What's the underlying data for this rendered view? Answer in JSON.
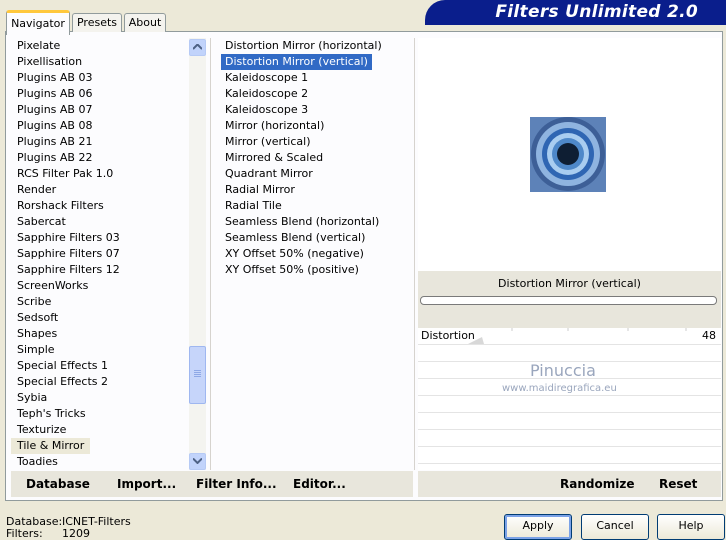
{
  "tabs": [
    {
      "label": "Navigator"
    },
    {
      "label": "Presets"
    },
    {
      "label": "About"
    }
  ],
  "banner_title": "Filters Unlimited 2.0",
  "categories": [
    "Pixelate",
    "Pixellisation",
    "Plugins AB 03",
    "Plugins AB 06",
    "Plugins AB 07",
    "Plugins AB 08",
    "Plugins AB 21",
    "Plugins AB 22",
    "RCS Filter Pak 1.0",
    "Render",
    "Rorshack Filters",
    "Sabercat",
    "Sapphire Filters 03",
    "Sapphire Filters 07",
    "Sapphire Filters 12",
    "ScreenWorks",
    "Scribe",
    "Sedsoft",
    "Shapes",
    "Simple",
    "Special Effects 1",
    "Special Effects 2",
    "Sybia",
    "Teph's Tricks",
    "Texturize",
    "Tile & Mirror",
    "Toadies"
  ],
  "selected_category": "Tile & Mirror",
  "filters": [
    "Distortion Mirror (horizontal)",
    "Distortion Mirror (vertical)",
    "Kaleidoscope 1",
    "Kaleidoscope 2",
    "Kaleidoscope 3",
    "Mirror (horizontal)",
    "Mirror (vertical)",
    "Mirrored & Scaled",
    "Quadrant Mirror",
    "Radial Mirror",
    "Radial Tile",
    "Seamless Blend (horizontal)",
    "Seamless Blend (vertical)",
    "XY Offset 50% (negative)",
    "XY Offset 50% (positive)"
  ],
  "selected_filter": "Distortion Mirror (vertical)",
  "current_filter_name": "Distortion Mirror (vertical)",
  "progress": 0,
  "params": [
    {
      "label": "Distortion",
      "value": "48"
    }
  ],
  "watermark": {
    "line1": "Pinuccia",
    "line2": "www.maidiregrafica.eu"
  },
  "bottom_left_buttons": {
    "database": "Database",
    "import": "Import...",
    "filter_info": "Filter Info...",
    "editor": "Editor..."
  },
  "bottom_right_buttons": {
    "randomize": "Randomize",
    "reset": "Reset"
  },
  "status": {
    "database_label": "Database:",
    "database_value": "ICNET-Filters",
    "filters_label": "Filters:",
    "filters_value": "1209"
  },
  "dialog_buttons": {
    "apply": "Apply",
    "cancel": "Cancel",
    "help": "Help"
  },
  "colors": {
    "banner": "#0a1e8c",
    "selection": "#316ac5",
    "panel": "#ece9d8"
  }
}
